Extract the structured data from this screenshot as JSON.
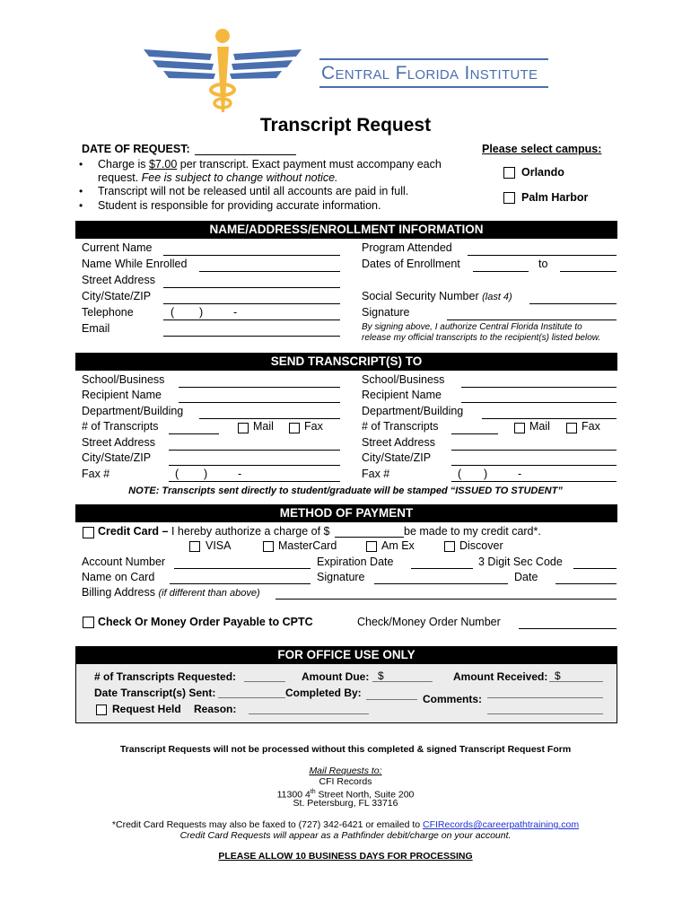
{
  "header": {
    "logo_icon": "caduceus-wings-logo",
    "institution_name": "Central Florida Institute",
    "brand_colors": {
      "blue": "#4a6fb0",
      "gold": "#f5b83f"
    }
  },
  "title": "Transcript Request",
  "date_of_request_label": "DATE OF REQUEST:",
  "bullets": {
    "charge_prefix": "Charge is ",
    "charge_amount": "$7.00",
    "charge_suffix": " per transcript.  Exact payment must accompany each",
    "charge_line2_plain": "request. ",
    "charge_line2_italic": "Fee is subject to change without notice.",
    "item2": "Transcript will not be released until all accounts are paid in full.",
    "item3": "Student is responsible for providing accurate information."
  },
  "campus": {
    "heading": "Please select campus:",
    "options": [
      "Orlando",
      "Palm Harbor"
    ]
  },
  "section_enrollment": {
    "heading": "NAME/ADDRESS/ENROLLMENT INFORMATION",
    "left_fields": [
      "Current Name",
      "Name While Enrolled",
      "Street Address",
      "City/State/ZIP",
      "Telephone",
      "Email"
    ],
    "phone_mask": {
      "open": "(",
      "close": ")",
      "dash": "-"
    },
    "program_attended": "Program Attended",
    "dates_of_enrollment": "Dates of Enrollment",
    "to_label": "to",
    "ssn_label": "Social Security Number",
    "ssn_note": "(last 4)",
    "signature_label": "Signature",
    "authorization_line1": "By signing above, I authorize Central Florida Institute to",
    "authorization_line2": "release my official transcripts to the recipient(s) listed below."
  },
  "section_send": {
    "heading": "SEND TRANSCRIPT(S) TO",
    "fields": [
      "School/Business",
      "Recipient Name",
      "Department/Building",
      "# of Transcripts",
      "Street Address",
      "City/State/ZIP",
      "Fax #"
    ],
    "mail_label": "Mail",
    "fax_label": "Fax",
    "note": "NOTE: Transcripts sent directly to student/graduate will be stamped “ISSUED TO STUDENT”"
  },
  "section_payment": {
    "heading": "METHOD OF PAYMENT",
    "credit_card_bold": "Credit Card –",
    "credit_card_text1": " I hereby authorize a charge of $",
    "credit_card_text2": " be made to my credit card*.",
    "card_types": [
      "VISA",
      "MasterCard",
      "Am Ex",
      "Discover"
    ],
    "account_number": "Account Number",
    "expiration_date": "Expiration Date",
    "sec_code": "3 Digit Sec Code",
    "name_on_card": "Name on Card",
    "signature": "Signature",
    "date": "Date",
    "billing_address": "Billing Address",
    "billing_note": "(if different than above)",
    "check_option": "Check Or Money Order Payable to CPTC",
    "check_number": "Check/Money Order Number"
  },
  "section_office": {
    "heading": "FOR OFFICE USE ONLY",
    "num_requested": "# of Transcripts Requested:",
    "amount_due": "Amount Due:",
    "amount_received": "Amount Received:",
    "currency": "$",
    "date_sent": "Date Transcript(s) Sent:",
    "completed_by": "Completed By:",
    "comments": "Comments:",
    "request_held": "Request Held",
    "reason": "Reason:"
  },
  "footer": {
    "warning": "Transcript Requests will not be processed without this completed & signed Transcript Request Form",
    "mail_heading": "Mail Requests to:",
    "address_name": "CFI Records",
    "address_street_pre": "11300 4",
    "address_street_sup": "th",
    "address_street_post": " Street North, Suite 200",
    "address_city": "St. Petersburg, FL 33716",
    "fax_line": "*Credit Card Requests may also be faxed to (727) 342-6421 or emailed to ",
    "email": "CFIRecords@careerpathtraining.com",
    "pathfinder_note": "Credit Card Requests will appear as a Pathfinder debit/charge on your account.",
    "processing": "PLEASE ALLOW 10 BUSINESS DAYS FOR PROCESSING"
  }
}
